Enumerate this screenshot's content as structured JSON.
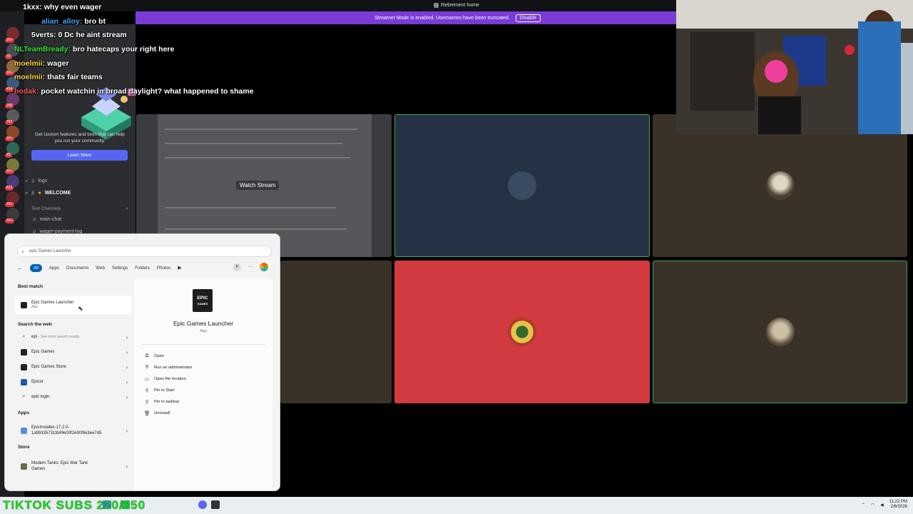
{
  "window": {
    "title": "Retirement home"
  },
  "streamer_banner": {
    "text": "Streamer Mode is enabled. Usernames have been truncated.",
    "disable_label": "Disable"
  },
  "chat": [
    {
      "user": "1kxx:",
      "message": "why even wager",
      "color": "#ffffff"
    },
    {
      "user": "alian_alloy:",
      "message": "bro bt",
      "color": "#4fa3ff"
    },
    {
      "user": "5verts:",
      "message": "0 Dc he aint stream",
      "color": "#ffffff"
    },
    {
      "user": "NLTeamBready:",
      "message": "bro hatecaps your right here",
      "color": "#39e639"
    },
    {
      "user": "moelmii:",
      "message": "wager",
      "color": "#ffd23f"
    },
    {
      "user": "moelmii:",
      "message": "thats fair teams",
      "color": "#ffd23f"
    },
    {
      "user": "bodak:",
      "message": "pocket watchin in broad daylight? what happened to shame",
      "color": "#ff5a5a"
    }
  ],
  "channel_panel": {
    "promo_text": "Get custom features and tools that can help you run your community.",
    "learn_more": "Learn More",
    "channels": [
      "logs",
      "WELCOME"
    ],
    "category": "Text Channels",
    "text_channels": [
      "main-chat",
      "wager-payment-log"
    ]
  },
  "server_badges": [
    "1K+",
    "79",
    "1K+",
    "414",
    "249",
    "767",
    "1K+",
    "15",
    "1K+",
    "812",
    "1K+",
    "1K+"
  ],
  "stage": {
    "watch_stream": "Watch Stream"
  },
  "start_menu": {
    "search_value": "epic Games Launcher",
    "filters": [
      "All",
      "Apps",
      "Documents",
      "Web",
      "Settings",
      "Folders",
      "Photos"
    ],
    "profile_initial": "K",
    "best_match_heading": "Best match",
    "best_match": {
      "name": "Epic Games Launcher",
      "kind": "App"
    },
    "search_web_heading": "Search the web",
    "web_results": [
      {
        "text": "epi",
        "sub": "- See more search results"
      },
      {
        "text": "Epic Games"
      },
      {
        "text": "Epic Games Store"
      },
      {
        "text": "Epicor"
      },
      {
        "text": "epic login"
      }
    ],
    "apps_heading": "Apps",
    "apps": [
      {
        "line1": "EpicInstaller-17.2.0-",
        "line2": "1a99335731fd49e09f2e90f8e3ee7d5"
      }
    ],
    "store_heading": "Store",
    "store": [
      {
        "line1": "Modern Tanks: Epic War Tank",
        "line2": "Games"
      }
    ],
    "detail": {
      "logo_line1": "EPIC",
      "logo_line2": "GAMES",
      "name": "Epic Games Launcher",
      "kind": "App",
      "actions": [
        "Open",
        "Run as administrator",
        "Open file location",
        "Pin to Start",
        "Pin to taskbar",
        "Uninstall"
      ]
    }
  },
  "taskbar": {
    "overlay_text": "TIKTOK SUBS 220/250",
    "time": "11:22 PM",
    "date": "2/6/2026"
  }
}
